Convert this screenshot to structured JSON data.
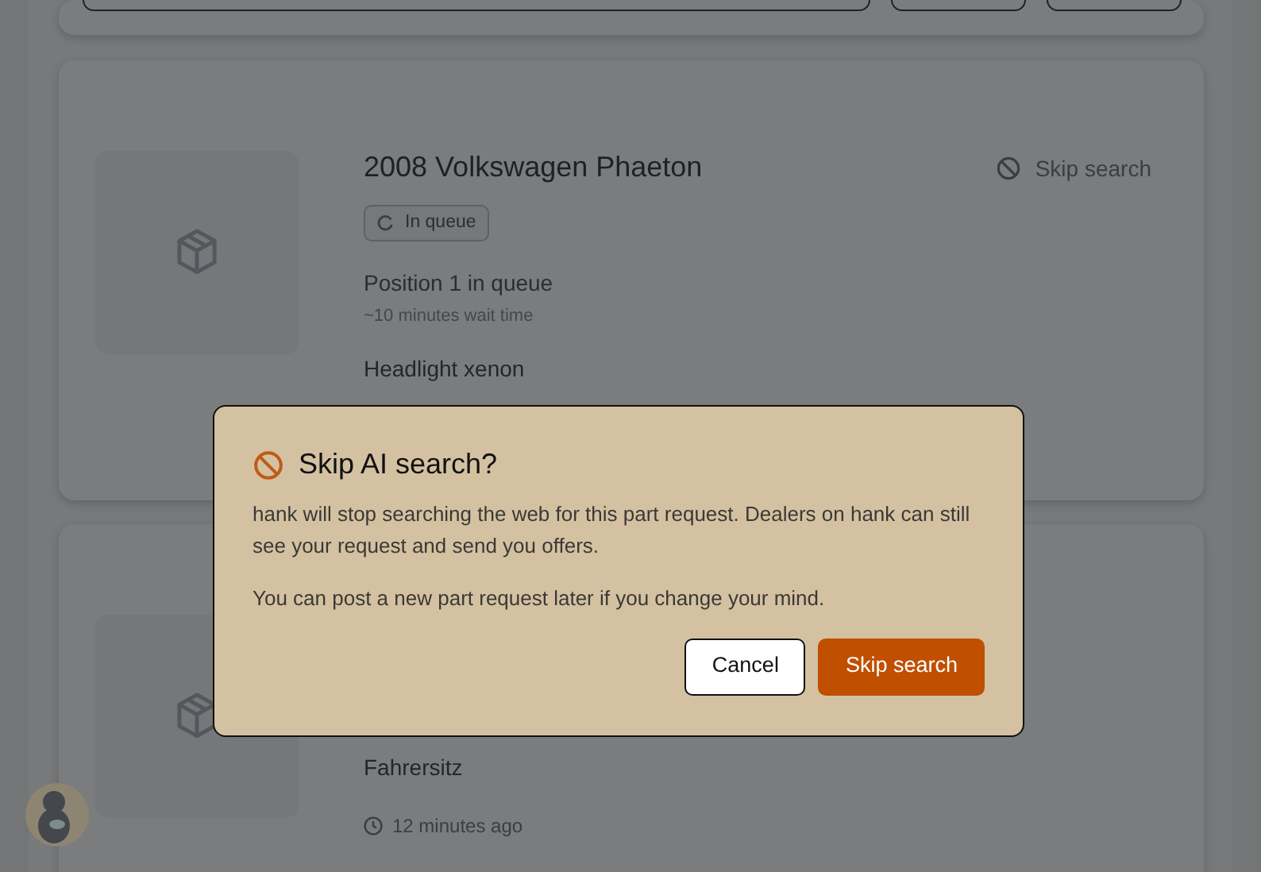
{
  "top_card": {
    "controls": [
      {
        "kind": "field"
      },
      {
        "kind": "button"
      },
      {
        "kind": "button"
      }
    ]
  },
  "requests": [
    {
      "title": "2008 Volkswagen Phaeton",
      "action": "Skip search",
      "status": "In queue",
      "position": "Position 1 in queue",
      "wait": "~10 minutes wait time",
      "part": "Headlight xenon"
    },
    {
      "part": "Fahrersitz",
      "time": "12 minutes ago"
    }
  ],
  "dialog": {
    "title": "Skip AI search?",
    "paragraphs": [
      "hank will stop searching the web for this part request. Dealers on hank can still see your request and send you offers.",
      "You can post a new part request later if you change your mind."
    ],
    "buttons": [
      {
        "label": "Cancel",
        "kind": "secondary"
      },
      {
        "label": "Skip search",
        "kind": "primary"
      }
    ]
  }
}
